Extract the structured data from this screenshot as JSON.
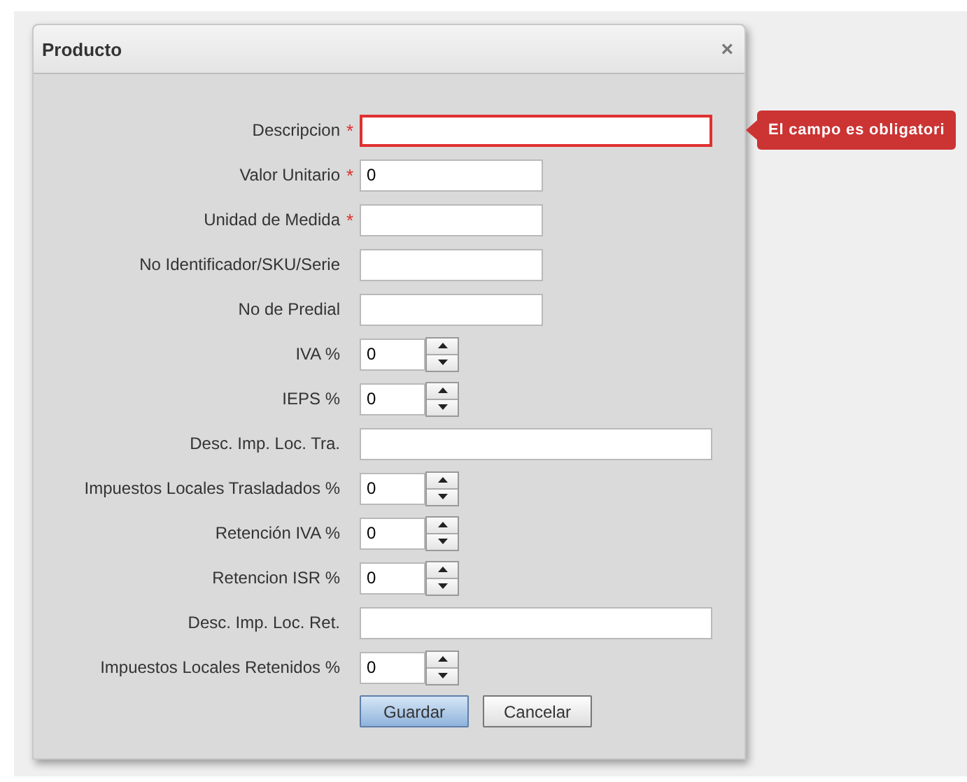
{
  "dialog": {
    "title": "Producto",
    "close": "×"
  },
  "fields": [
    {
      "label": "Descripcion",
      "kind": "wide",
      "required": true,
      "error": true
    },
    {
      "label": "Valor Unitario",
      "kind": "text",
      "required": true,
      "error": false,
      "value": "0"
    },
    {
      "label": "Unidad de Medida",
      "kind": "text",
      "required": true,
      "error": false
    },
    {
      "label": "No Identificador/SKU/Serie",
      "kind": "text",
      "required": false,
      "error": false
    },
    {
      "label": "No de Predial",
      "kind": "text",
      "required": false,
      "error": false
    },
    {
      "label": "IVA %",
      "kind": "spinner",
      "required": false,
      "error": false,
      "value": "0"
    },
    {
      "label": "IEPS %",
      "kind": "spinner",
      "required": false,
      "error": false,
      "value": "0"
    },
    {
      "label": "Desc. Imp. Loc. Tra.",
      "kind": "wide",
      "required": false,
      "error": false
    },
    {
      "label": "Impuestos Locales Trasladados %",
      "kind": "spinner",
      "required": false,
      "error": false,
      "value": "0"
    },
    {
      "label": "Retención IVA %",
      "kind": "spinner",
      "required": false,
      "error": false,
      "value": "0"
    },
    {
      "label": "Retencion ISR %",
      "kind": "spinner",
      "required": false,
      "error": false,
      "value": "0"
    },
    {
      "label": "Desc. Imp. Loc. Ret.",
      "kind": "wide",
      "required": false,
      "error": false
    },
    {
      "label": "Impuestos Locales Retenidos %",
      "kind": "spinner",
      "required": false,
      "error": false,
      "value": "0"
    }
  ],
  "required_mark": "*",
  "error_tooltip": "El campo es obligatori",
  "buttons": [
    {
      "label": "Guardar",
      "primary": true
    },
    {
      "label": "Cancelar",
      "primary": false
    }
  ]
}
